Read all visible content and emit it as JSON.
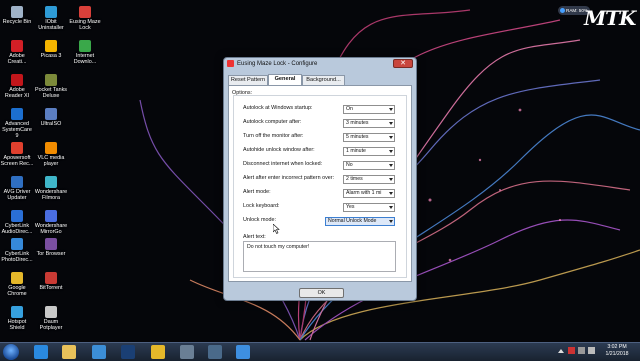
{
  "desktop": {
    "icons": [
      {
        "label": "Recycle Bin",
        "color": "#9fb2c8"
      },
      {
        "label": "IObit Uninstaller",
        "color": "#2e9bd6"
      },
      {
        "label": "Eusing Maze Lock",
        "color": "#d9403a"
      },
      {
        "label": "Adobe Creati...",
        "color": "#d21f26"
      },
      {
        "label": "Picasa 3",
        "color": "#f4b400"
      },
      {
        "label": "Internet Downlo...",
        "color": "#3aa84a"
      },
      {
        "label": "Adobe Reader XI",
        "color": "#c2161b"
      },
      {
        "label": "Pocket Tanks Deluxe",
        "color": "#7c8a3a"
      },
      {
        "label": "Advanced SystemCare 9",
        "color": "#1c6fd0"
      },
      {
        "label": "UltraISO",
        "color": "#5b7ec2"
      },
      {
        "label": "Apowersoft Screen Rec...",
        "color": "#e0402e"
      },
      {
        "label": "VLC media player",
        "color": "#f28c00"
      },
      {
        "label": "AVG Driver Updater",
        "color": "#2f6fc2"
      },
      {
        "label": "Wondershare Filmora",
        "color": "#3fb6c9"
      },
      {
        "label": "CyberLink AudioDirec...",
        "color": "#2a6fd6"
      },
      {
        "label": "Wondershare MirrorGo",
        "color": "#4a6de0"
      },
      {
        "label": "CyberLink PhotoDirec...",
        "color": "#3689d9"
      },
      {
        "label": "Tor Browser",
        "color": "#7a4fa0"
      },
      {
        "label": "Google Chrome",
        "color": "#e5b82a"
      },
      {
        "label": "BitTorrent",
        "color": "#c93a34"
      },
      {
        "label": "Hotspot Shield",
        "color": "#36a0de"
      },
      {
        "label": "Daum Potplayer",
        "color": "#c8c8c8"
      }
    ]
  },
  "overlay": {
    "ram_widget": "RAM: 50%",
    "logo_text": "MTK"
  },
  "dialog": {
    "title": "Eusing Maze Lock - Configure",
    "close_label": "✕",
    "tabs": [
      "Reset Pattern",
      "General",
      "Background..."
    ],
    "active_tab": "General",
    "group_label": "Options:",
    "rows": [
      {
        "label": "Autolock at Windows startup:",
        "value": "On"
      },
      {
        "label": "Autolock computer after:",
        "value": "3 minutes"
      },
      {
        "label": "Turn off the monitor after:",
        "value": "5 minutes"
      },
      {
        "label": "Autohide unlock window after:",
        "value": "1 minute"
      },
      {
        "label": "Disconnect internet when locked:",
        "value": "No"
      },
      {
        "label": "Alert after enter incorrect pattern over:",
        "value": "2 times"
      },
      {
        "label": "Alert mode:",
        "value": "Alarm with 1 mi"
      },
      {
        "label": "Lock keyboard:",
        "value": "Yes"
      },
      {
        "label": "Unlock mode:",
        "value": "Normal Unlock Mode"
      }
    ],
    "alert_text_label": "Alert text:",
    "alert_text_value": "Do not touch my computer!",
    "ok_label": "OK"
  },
  "taskbar": {
    "apps": [
      {
        "name": "internet-explorer",
        "color": "#2a8ae0"
      },
      {
        "name": "file-explorer",
        "color": "#e8c15a"
      },
      {
        "name": "hotspot",
        "color": "#3c8ed6"
      },
      {
        "name": "photoshop",
        "color": "#1a3f74"
      },
      {
        "name": "chrome",
        "color": "#e5b82a"
      },
      {
        "name": "window-app",
        "color": "#6a7f95"
      },
      {
        "name": "screen-recorder",
        "color": "#4a6a8a"
      },
      {
        "name": "media-player",
        "color": "#3e8fe0"
      }
    ],
    "clock_time": "3:02 PM",
    "clock_date": "1/21/2018"
  }
}
